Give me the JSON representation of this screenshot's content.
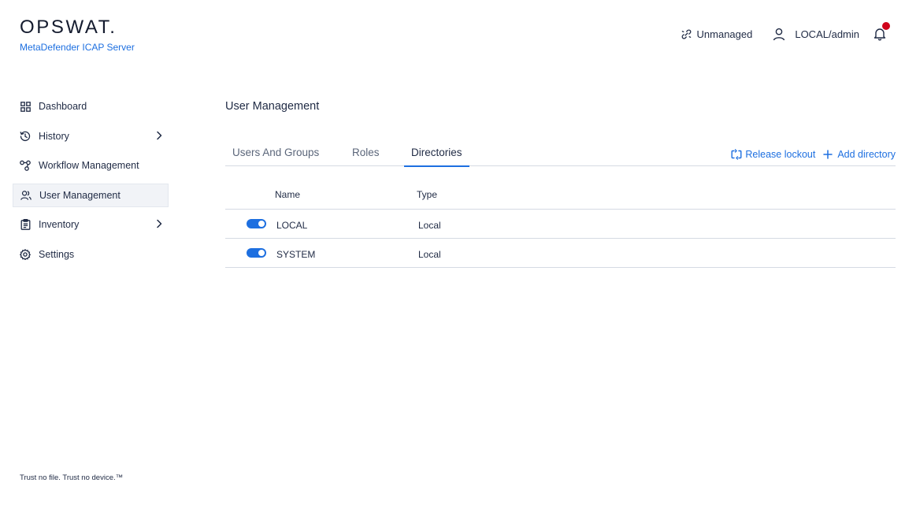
{
  "brand": {
    "logo_text": "OPSWAT.",
    "product": "MetaDefender ICAP Server",
    "tagline": "Trust no file. Trust no device.™"
  },
  "topbar": {
    "status": "Unmanaged",
    "user": "LOCAL/admin",
    "notification_indicator_color": "#d0021b"
  },
  "sidebar": {
    "items": [
      {
        "label": "Dashboard",
        "icon": "grid-icon"
      },
      {
        "label": "History",
        "icon": "history-icon",
        "expandable": true
      },
      {
        "label": "Workflow Management",
        "icon": "workflow-icon"
      },
      {
        "label": "User Management",
        "icon": "users-icon",
        "active": true
      },
      {
        "label": "Inventory",
        "icon": "clipboard-icon",
        "expandable": true
      },
      {
        "label": "Settings",
        "icon": "gear-icon"
      }
    ]
  },
  "main": {
    "title": "User Management",
    "tabs": [
      {
        "label": "Users And Groups"
      },
      {
        "label": "Roles"
      },
      {
        "label": "Directories",
        "active": true
      }
    ],
    "actions": {
      "release_lockout": "Release lockout",
      "add_directory": "Add directory"
    },
    "table": {
      "columns": [
        "Name",
        "Type"
      ],
      "rows": [
        {
          "enabled": true,
          "name": "LOCAL",
          "type": "Local"
        },
        {
          "enabled": true,
          "name": "SYSTEM",
          "type": "Local"
        }
      ]
    }
  },
  "colors": {
    "accent": "#1d6fe0",
    "text": "#1f2a44",
    "divider": "#d5dae3",
    "active_nav_bg": "#f1f3f7"
  }
}
